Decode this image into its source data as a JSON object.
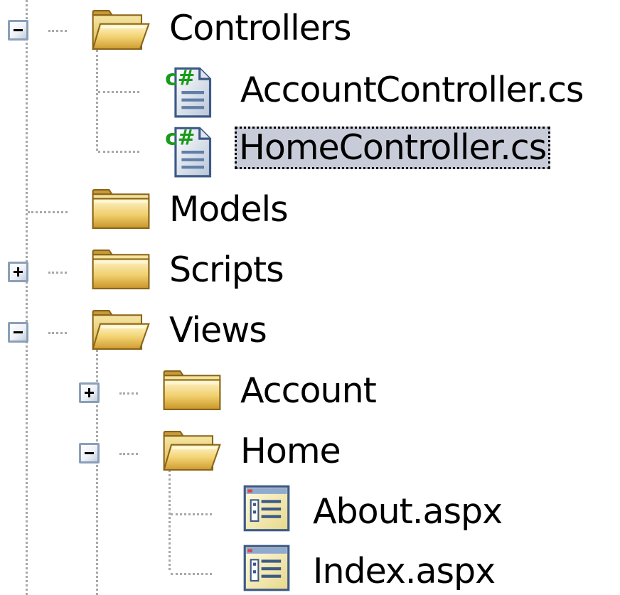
{
  "solution_explorer": {
    "items": [
      {
        "id": "controllers",
        "label": "Controllers",
        "type": "folder",
        "state": "expanded",
        "selected": false
      },
      {
        "id": "account-controller",
        "label": "AccountController.cs",
        "type": "csharp-file",
        "selected": false
      },
      {
        "id": "home-controller",
        "label": "HomeController.cs",
        "type": "csharp-file",
        "selected": true
      },
      {
        "id": "models",
        "label": "Models",
        "type": "folder",
        "state": "leaf",
        "selected": false
      },
      {
        "id": "scripts",
        "label": "Scripts",
        "type": "folder",
        "state": "collapsed",
        "selected": false
      },
      {
        "id": "views",
        "label": "Views",
        "type": "folder",
        "state": "expanded",
        "selected": false
      },
      {
        "id": "views-account",
        "label": "Account",
        "type": "folder",
        "state": "collapsed",
        "selected": false
      },
      {
        "id": "views-home",
        "label": "Home",
        "type": "folder",
        "state": "expanded",
        "selected": false
      },
      {
        "id": "about-aspx",
        "label": "About.aspx",
        "type": "aspx-file",
        "selected": false
      },
      {
        "id": "index-aspx",
        "label": "Index.aspx",
        "type": "aspx-file",
        "selected": false
      }
    ]
  },
  "icons": {
    "folder_closed": "folder-closed-icon",
    "folder_open": "folder-open-icon",
    "csharp_file": "csharp-file-icon",
    "aspx_file": "aspx-file-icon",
    "expand": "plus-box-icon",
    "collapse": "minus-box-icon"
  },
  "colors": {
    "selection_background": "#c8ccd8",
    "tree_lines": "#a8a8a8",
    "csharp_badge": "#1a9a1a",
    "toggle_border": "#8a9fb8"
  }
}
